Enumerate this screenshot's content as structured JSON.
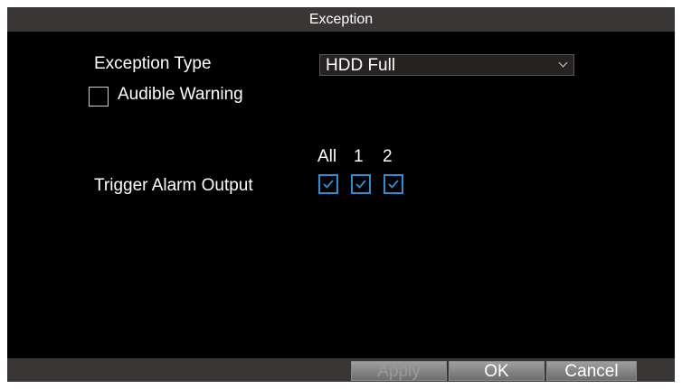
{
  "dialog": {
    "title": "Exception",
    "exception_type_label": "Exception Type",
    "exception_type_value": "HDD Full",
    "audible_warning_label": "Audible Warning",
    "audible_warning_checked": false,
    "trigger_alarm_label": "Trigger Alarm Output",
    "alarm_columns": [
      "All",
      "1",
      "2"
    ],
    "alarm_checked": [
      true,
      true,
      true
    ]
  },
  "buttons": {
    "apply": "Apply",
    "ok": "OK",
    "cancel": "Cancel"
  },
  "colors": {
    "accent": "#2c8fd6",
    "titlebar": "#3b3636",
    "background": "#000000"
  }
}
